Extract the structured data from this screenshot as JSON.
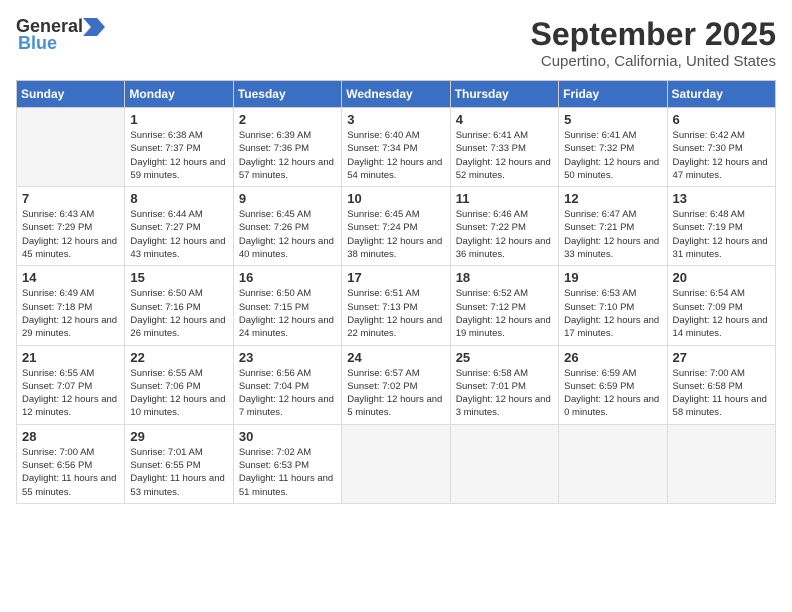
{
  "logo": {
    "general": "General",
    "blue": "Blue"
  },
  "title": "September 2025",
  "location": "Cupertino, California, United States",
  "days_header": [
    "Sunday",
    "Monday",
    "Tuesday",
    "Wednesday",
    "Thursday",
    "Friday",
    "Saturday"
  ],
  "weeks": [
    [
      {
        "day": "",
        "info": ""
      },
      {
        "day": "1",
        "info": "Sunrise: 6:38 AM\nSunset: 7:37 PM\nDaylight: 12 hours and 59 minutes."
      },
      {
        "day": "2",
        "info": "Sunrise: 6:39 AM\nSunset: 7:36 PM\nDaylight: 12 hours and 57 minutes."
      },
      {
        "day": "3",
        "info": "Sunrise: 6:40 AM\nSunset: 7:34 PM\nDaylight: 12 hours and 54 minutes."
      },
      {
        "day": "4",
        "info": "Sunrise: 6:41 AM\nSunset: 7:33 PM\nDaylight: 12 hours and 52 minutes."
      },
      {
        "day": "5",
        "info": "Sunrise: 6:41 AM\nSunset: 7:32 PM\nDaylight: 12 hours and 50 minutes."
      },
      {
        "day": "6",
        "info": "Sunrise: 6:42 AM\nSunset: 7:30 PM\nDaylight: 12 hours and 47 minutes."
      }
    ],
    [
      {
        "day": "7",
        "info": "Sunrise: 6:43 AM\nSunset: 7:29 PM\nDaylight: 12 hours and 45 minutes."
      },
      {
        "day": "8",
        "info": "Sunrise: 6:44 AM\nSunset: 7:27 PM\nDaylight: 12 hours and 43 minutes."
      },
      {
        "day": "9",
        "info": "Sunrise: 6:45 AM\nSunset: 7:26 PM\nDaylight: 12 hours and 40 minutes."
      },
      {
        "day": "10",
        "info": "Sunrise: 6:45 AM\nSunset: 7:24 PM\nDaylight: 12 hours and 38 minutes."
      },
      {
        "day": "11",
        "info": "Sunrise: 6:46 AM\nSunset: 7:22 PM\nDaylight: 12 hours and 36 minutes."
      },
      {
        "day": "12",
        "info": "Sunrise: 6:47 AM\nSunset: 7:21 PM\nDaylight: 12 hours and 33 minutes."
      },
      {
        "day": "13",
        "info": "Sunrise: 6:48 AM\nSunset: 7:19 PM\nDaylight: 12 hours and 31 minutes."
      }
    ],
    [
      {
        "day": "14",
        "info": "Sunrise: 6:49 AM\nSunset: 7:18 PM\nDaylight: 12 hours and 29 minutes."
      },
      {
        "day": "15",
        "info": "Sunrise: 6:50 AM\nSunset: 7:16 PM\nDaylight: 12 hours and 26 minutes."
      },
      {
        "day": "16",
        "info": "Sunrise: 6:50 AM\nSunset: 7:15 PM\nDaylight: 12 hours and 24 minutes."
      },
      {
        "day": "17",
        "info": "Sunrise: 6:51 AM\nSunset: 7:13 PM\nDaylight: 12 hours and 22 minutes."
      },
      {
        "day": "18",
        "info": "Sunrise: 6:52 AM\nSunset: 7:12 PM\nDaylight: 12 hours and 19 minutes."
      },
      {
        "day": "19",
        "info": "Sunrise: 6:53 AM\nSunset: 7:10 PM\nDaylight: 12 hours and 17 minutes."
      },
      {
        "day": "20",
        "info": "Sunrise: 6:54 AM\nSunset: 7:09 PM\nDaylight: 12 hours and 14 minutes."
      }
    ],
    [
      {
        "day": "21",
        "info": "Sunrise: 6:55 AM\nSunset: 7:07 PM\nDaylight: 12 hours and 12 minutes."
      },
      {
        "day": "22",
        "info": "Sunrise: 6:55 AM\nSunset: 7:06 PM\nDaylight: 12 hours and 10 minutes."
      },
      {
        "day": "23",
        "info": "Sunrise: 6:56 AM\nSunset: 7:04 PM\nDaylight: 12 hours and 7 minutes."
      },
      {
        "day": "24",
        "info": "Sunrise: 6:57 AM\nSunset: 7:02 PM\nDaylight: 12 hours and 5 minutes."
      },
      {
        "day": "25",
        "info": "Sunrise: 6:58 AM\nSunset: 7:01 PM\nDaylight: 12 hours and 3 minutes."
      },
      {
        "day": "26",
        "info": "Sunrise: 6:59 AM\nSunset: 6:59 PM\nDaylight: 12 hours and 0 minutes."
      },
      {
        "day": "27",
        "info": "Sunrise: 7:00 AM\nSunset: 6:58 PM\nDaylight: 11 hours and 58 minutes."
      }
    ],
    [
      {
        "day": "28",
        "info": "Sunrise: 7:00 AM\nSunset: 6:56 PM\nDaylight: 11 hours and 55 minutes."
      },
      {
        "day": "29",
        "info": "Sunrise: 7:01 AM\nSunset: 6:55 PM\nDaylight: 11 hours and 53 minutes."
      },
      {
        "day": "30",
        "info": "Sunrise: 7:02 AM\nSunset: 6:53 PM\nDaylight: 11 hours and 51 minutes."
      },
      {
        "day": "",
        "info": ""
      },
      {
        "day": "",
        "info": ""
      },
      {
        "day": "",
        "info": ""
      },
      {
        "day": "",
        "info": ""
      }
    ]
  ]
}
